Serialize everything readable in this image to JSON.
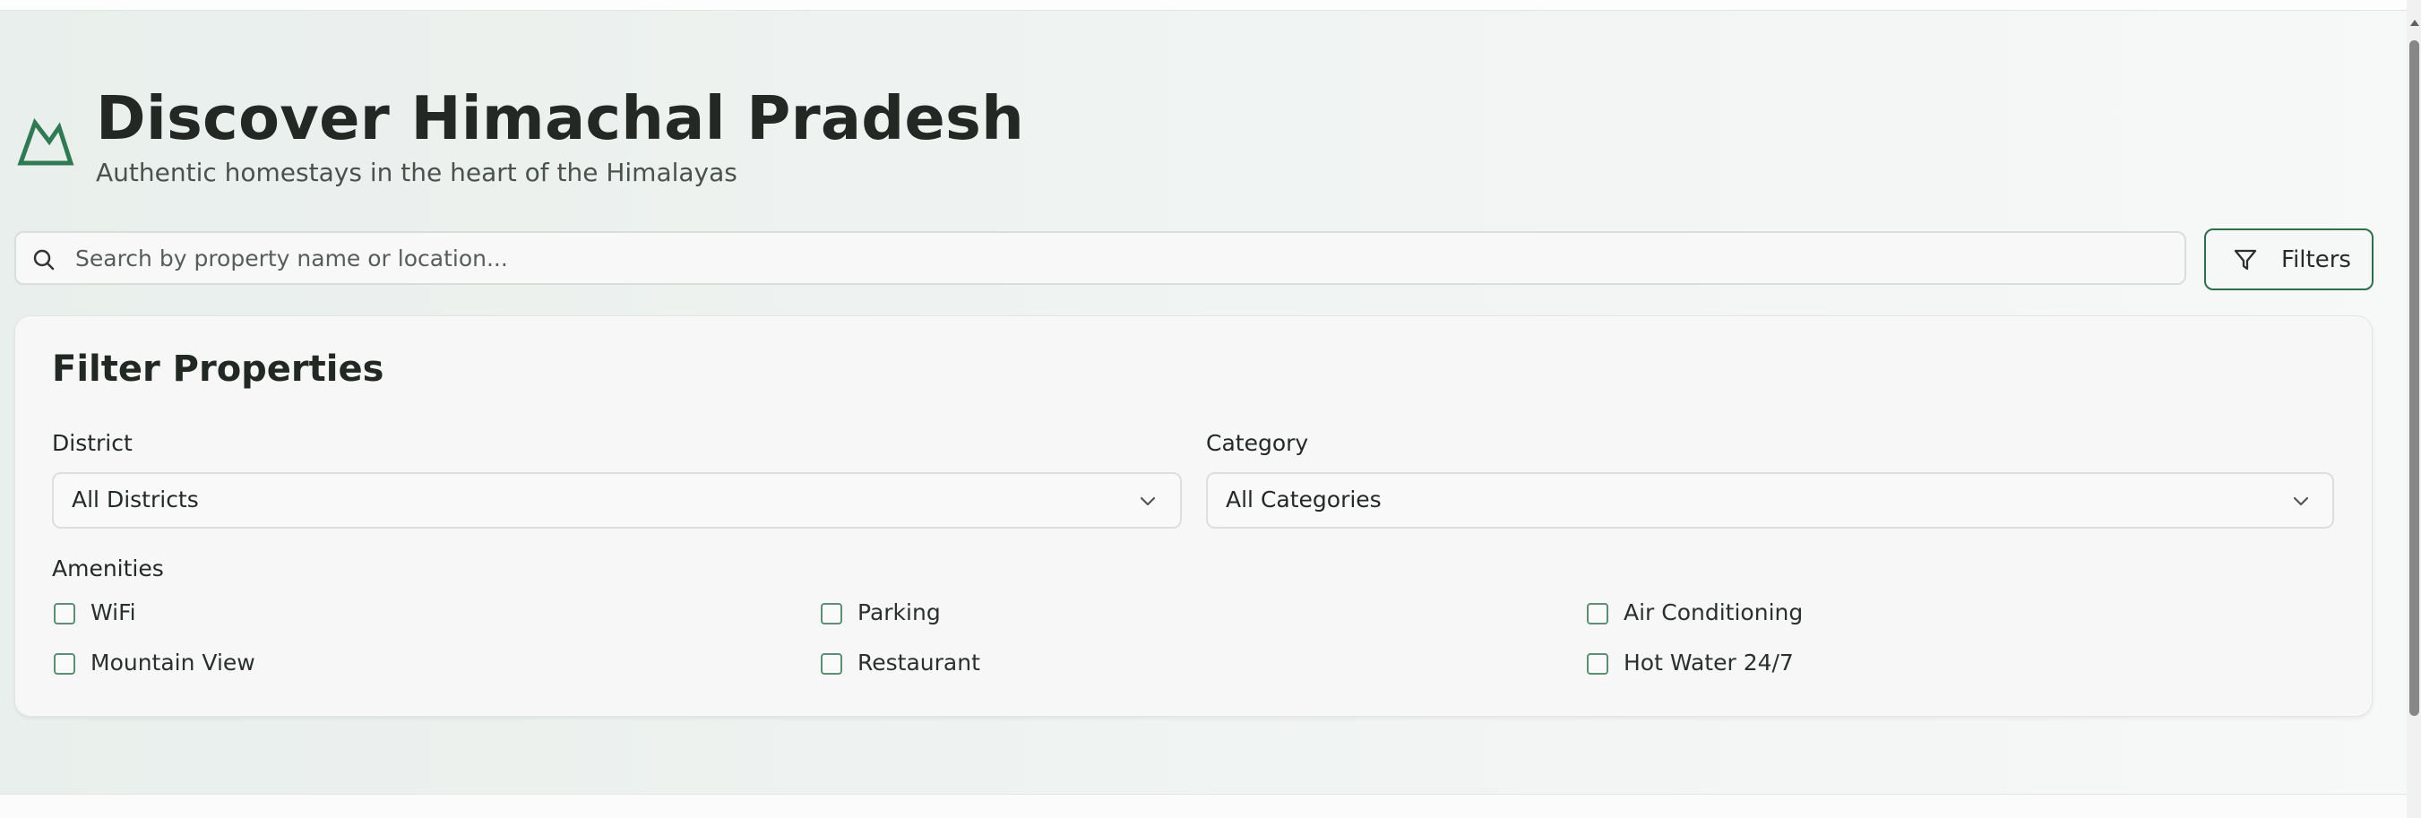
{
  "header": {
    "title": "Discover Himachal Pradesh",
    "subtitle": "Authentic homestays in the heart of the Himalayas",
    "logo_icon": "mountain-icon"
  },
  "search": {
    "placeholder": "Search by property name or location...",
    "value": "",
    "icon": "search-icon"
  },
  "filters_button": {
    "label": "Filters",
    "icon": "filter-icon"
  },
  "filter_panel": {
    "title": "Filter Properties",
    "district": {
      "label": "District",
      "selected": "All Districts"
    },
    "category": {
      "label": "Category",
      "selected": "All Categories"
    },
    "amenities": {
      "label": "Amenities",
      "items": [
        {
          "label": "WiFi",
          "checked": false
        },
        {
          "label": "Parking",
          "checked": false
        },
        {
          "label": "Air Conditioning",
          "checked": false
        },
        {
          "label": "Mountain View",
          "checked": false
        },
        {
          "label": "Restaurant",
          "checked": false
        },
        {
          "label": "Hot Water 24/7",
          "checked": false
        }
      ]
    }
  },
  "colors": {
    "accent": "#2f6e4c",
    "text": "#222823",
    "background": "#eef3f0"
  }
}
